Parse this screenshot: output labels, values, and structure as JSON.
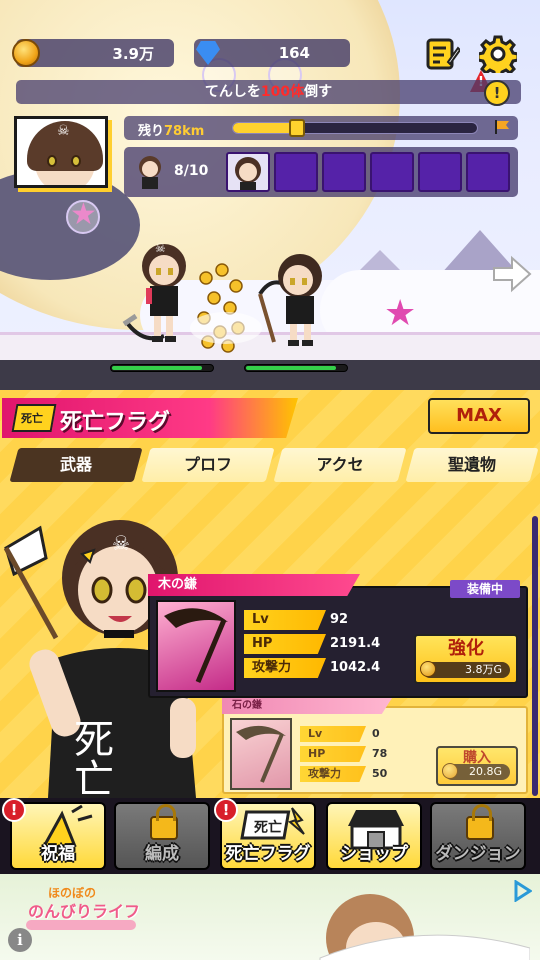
{
  "header": {
    "coins": "3.9万",
    "gems": "164",
    "quest_text_before": "てんしを",
    "quest_highlight": "100体",
    "quest_text_after": "倒す",
    "quest_alert": "!"
  },
  "stage": {
    "distance_label": "残り",
    "distance_value": "78km",
    "distance_progress": 0.26,
    "wave_count": "8/10",
    "filled_slots": 1,
    "total_slots": 6,
    "player_hp": 0.9,
    "enemy_hp": 0.9
  },
  "menu": {
    "title": "死亡フラグ",
    "title_badge": "死亡",
    "max_label": "MAX",
    "tabs": [
      {
        "label": "武器",
        "active": true
      },
      {
        "label": "プロフ",
        "active": false
      },
      {
        "label": "アクセ",
        "active": false
      },
      {
        "label": "聖遺物",
        "active": false
      }
    ],
    "heroine_shirt_text": "死亡"
  },
  "item_main": {
    "name": "木の鎌",
    "equipped_label": "装備中",
    "stats": [
      {
        "label": "Lv",
        "value": "92"
      },
      {
        "label": "HP",
        "value": "2191.4"
      },
      {
        "label": "攻撃力",
        "value": "1042.4"
      }
    ],
    "upgrade_label": "強化",
    "upgrade_cost": "3.8万G"
  },
  "item_next": {
    "name": "石の鎌",
    "stats": [
      {
        "label": "Lv",
        "value": "0"
      },
      {
        "label": "HP",
        "value": "78"
      },
      {
        "label": "攻撃力",
        "value": "50"
      }
    ],
    "buy_label": "購入",
    "buy_cost": "20.8G"
  },
  "nav": [
    {
      "label": "祝福",
      "locked": false,
      "alert": true
    },
    {
      "label": "編成",
      "locked": true,
      "alert": false
    },
    {
      "label": "死亡フラグ",
      "locked": false,
      "alert": true
    },
    {
      "label": "ショップ",
      "locked": false,
      "alert": false
    },
    {
      "label": "ダンジョン",
      "locked": true,
      "alert": false
    }
  ],
  "ad": {
    "logo_top": "ほのぼの",
    "logo_main": "のんびりライフ",
    "info": "i"
  },
  "colors": {
    "accent_pink": "#e0156d",
    "accent_yellow": "#ffd21e",
    "panel_purple": "#463c6e",
    "slot_purple": "#5522a8"
  }
}
